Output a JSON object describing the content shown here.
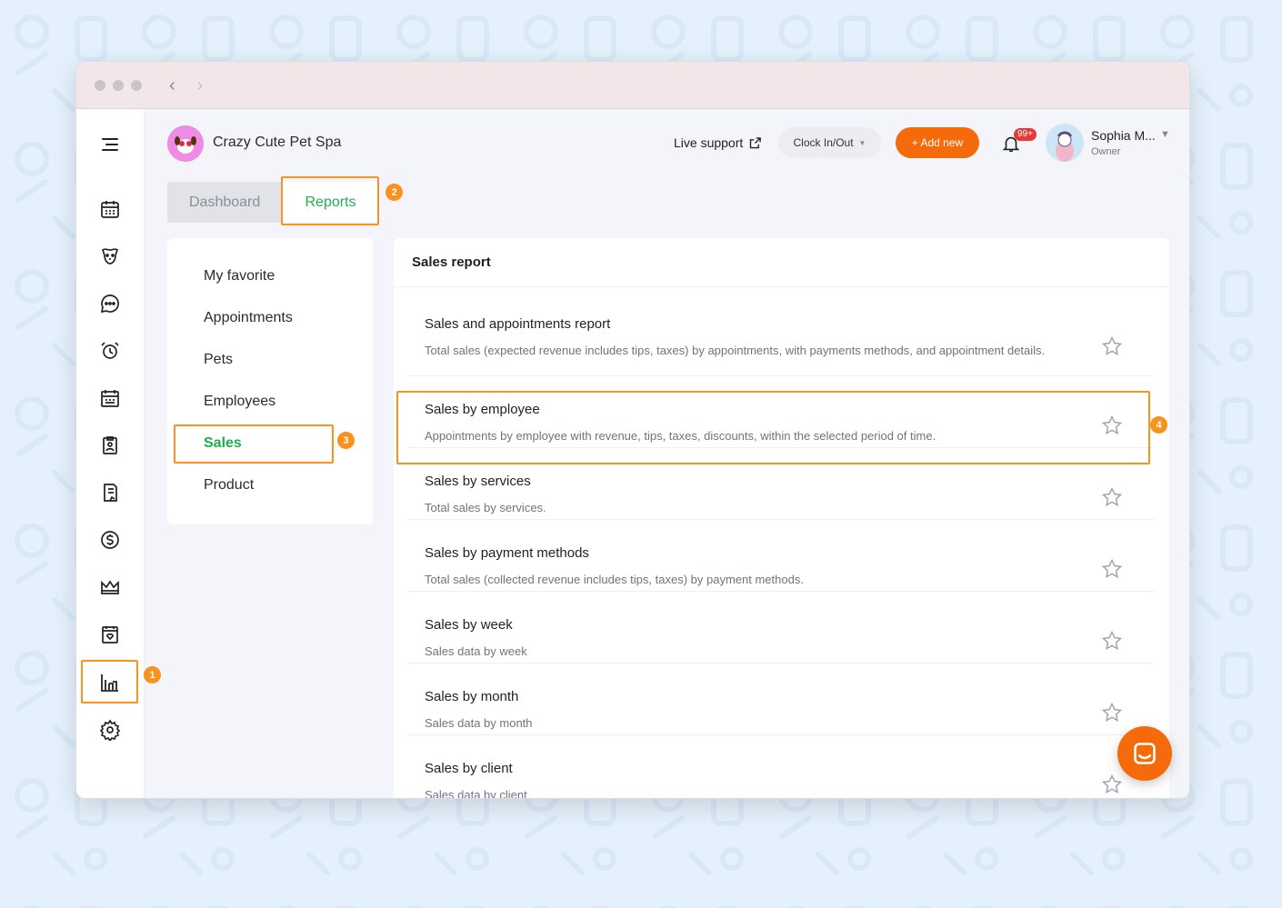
{
  "window": {
    "back_icon": "chevron-left-icon",
    "forward_icon": "chevron-right-icon"
  },
  "sidebar": {
    "items": [
      {
        "name": "menu-icon"
      },
      {
        "name": "calendar-icon"
      },
      {
        "name": "pet-icon"
      },
      {
        "name": "chat-icon"
      },
      {
        "name": "alarm-clock-icon"
      },
      {
        "name": "schedule-icon"
      },
      {
        "name": "clipboard-icon"
      },
      {
        "name": "document-icon"
      },
      {
        "name": "dollar-icon"
      },
      {
        "name": "crown-icon"
      },
      {
        "name": "booking-icon"
      },
      {
        "name": "reports-chart-icon"
      },
      {
        "name": "settings-icon"
      }
    ]
  },
  "header": {
    "business_name": "Crazy Cute Pet Spa",
    "live_support": "Live support",
    "clock_button": "Clock In/Out",
    "add_button": "+ Add new",
    "notification_badge": "99+",
    "user_name": "Sophia M...",
    "user_role": "Owner"
  },
  "tabs": {
    "dashboard": "Dashboard",
    "reports": "Reports"
  },
  "report_menu": {
    "items": [
      "My favorite",
      "Appointments",
      "Pets",
      "Employees",
      "Sales",
      "Product"
    ],
    "active": "Sales"
  },
  "sales_report": {
    "title": "Sales report",
    "rows": [
      {
        "title": "Sales and appointments report",
        "desc": "Total sales (expected revenue includes tips, taxes) by appointments, with payments methods, and appointment details."
      },
      {
        "title": "Sales by employee",
        "desc": "Appointments by employee with revenue, tips, taxes, discounts, within the selected period of time."
      },
      {
        "title": "Sales by services",
        "desc": "Total sales by services."
      },
      {
        "title": "Sales by payment methods",
        "desc": "Total sales (collected revenue includes tips, taxes) by payment methods."
      },
      {
        "title": "Sales by week",
        "desc": "Sales data by week"
      },
      {
        "title": "Sales by month",
        "desc": "Sales data by month"
      },
      {
        "title": "Sales by client",
        "desc": "Sales data by client"
      }
    ]
  },
  "callouts": [
    "1",
    "2",
    "3",
    "4"
  ],
  "colors": {
    "accent": "#f56a0a",
    "active_green": "#1fae4f",
    "highlight": "#f7931e",
    "badge_red": "#e53a3a"
  }
}
